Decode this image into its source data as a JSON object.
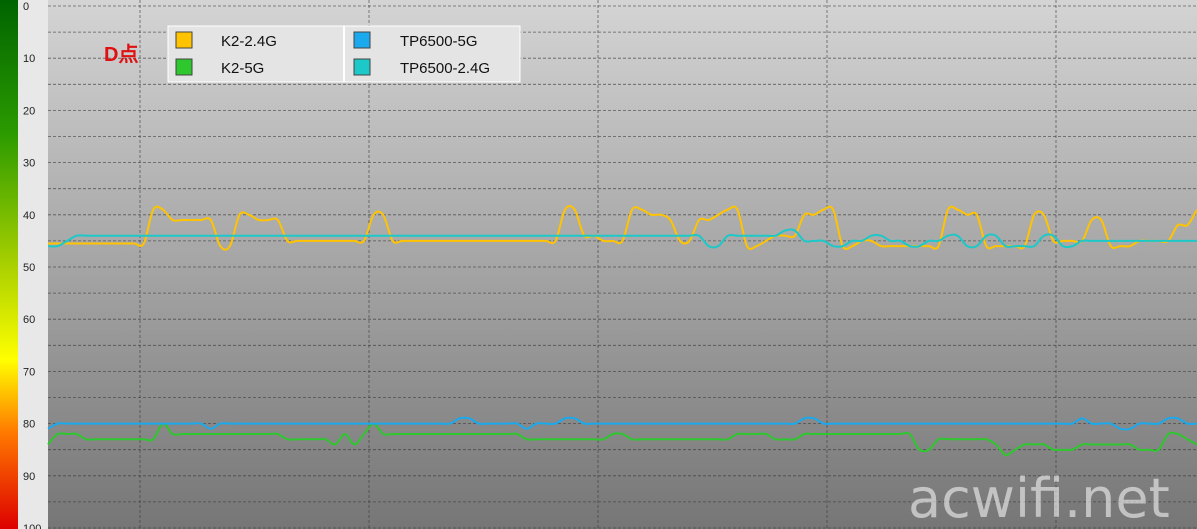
{
  "chart_data": {
    "type": "line",
    "annotation": "D点",
    "watermark": "acwifi.net",
    "ylim": [
      0,
      100
    ],
    "y_inverted": true,
    "yticks": [
      "0",
      "10",
      "20",
      "30",
      "40",
      "50",
      "60",
      "70",
      "80",
      "90",
      "100"
    ],
    "grid": true,
    "legend_position": "top-left",
    "x": [
      0,
      1,
      2,
      3,
      4,
      5,
      6,
      7,
      8,
      9,
      10,
      11,
      12,
      13,
      14,
      15,
      16,
      17,
      18,
      19,
      20,
      21,
      22,
      23,
      24,
      25,
      26,
      27,
      28,
      29,
      30,
      31,
      32,
      33,
      34,
      35,
      36,
      37,
      38,
      39,
      40,
      41,
      42,
      43,
      44,
      45,
      46,
      47,
      48,
      49,
      50,
      51,
      52,
      53,
      54,
      55,
      56,
      57,
      58,
      59,
      60,
      61,
      62,
      63,
      64,
      65,
      66,
      67,
      68,
      69,
      70,
      71,
      72,
      73,
      74,
      75,
      76,
      77,
      78,
      79,
      80,
      81,
      82,
      83,
      84,
      85,
      86,
      87,
      88,
      89,
      90,
      91,
      92,
      93,
      94,
      95,
      96,
      97,
      98,
      99,
      100,
      101,
      102,
      103,
      104,
      105,
      106,
      107,
      108,
      109,
      110,
      111,
      112,
      113,
      114,
      115,
      116,
      117,
      118,
      119,
      120
    ],
    "series": [
      {
        "name": "K2-2.4G",
        "color": "#ffc300",
        "values": [
          45.5,
          45.5,
          45.5,
          45.5,
          45.5,
          45.5,
          45.5,
          45.5,
          45.5,
          45.5,
          45.5,
          39,
          39,
          41,
          41,
          41,
          41,
          41,
          46,
          46,
          40,
          40,
          41,
          41,
          41,
          45,
          45,
          45,
          45,
          45,
          45,
          45,
          45,
          45,
          40,
          40,
          45,
          45,
          45,
          45,
          45,
          45,
          45,
          45,
          45,
          45,
          45,
          45,
          45,
          45,
          45,
          45,
          45,
          45,
          39,
          39,
          44,
          44,
          45,
          45,
          45,
          39,
          39,
          40,
          40,
          41,
          45,
          45,
          41,
          41,
          40,
          39,
          39,
          46,
          46,
          45,
          44,
          44,
          44,
          40,
          40,
          39,
          39,
          46,
          46,
          45,
          45,
          46,
          46,
          46,
          46,
          46,
          46,
          46,
          39,
          39,
          40,
          40,
          46,
          46,
          46,
          46,
          46,
          40,
          40,
          45,
          45,
          45,
          45,
          41,
          41,
          46,
          46,
          46,
          45,
          45,
          45,
          45,
          42,
          42,
          39
        ]
      },
      {
        "name": "K2-5G",
        "color": "#2ec72e",
        "values": [
          84,
          82,
          82,
          82,
          83,
          83,
          83,
          83,
          83,
          83,
          83,
          83,
          80,
          82,
          82,
          82,
          82,
          82,
          82,
          82,
          82,
          82,
          82,
          82,
          82,
          83,
          83,
          83,
          83,
          83,
          84,
          82,
          84,
          82,
          80,
          82,
          82,
          82,
          82,
          82,
          82,
          82,
          82,
          82,
          82,
          82,
          82,
          82,
          82,
          82,
          83,
          83,
          83,
          83,
          83,
          83,
          83,
          83,
          83,
          82,
          82,
          83,
          83,
          83,
          83,
          83,
          83,
          83,
          83,
          83,
          83,
          83,
          82,
          82,
          82,
          82,
          83,
          83,
          83,
          82,
          82,
          82,
          82,
          82,
          82,
          82,
          82,
          82,
          82,
          82,
          82,
          85,
          85,
          83,
          83,
          83,
          83,
          83,
          83,
          84,
          86,
          85,
          84,
          84,
          84,
          85,
          85,
          85,
          84,
          84,
          84,
          84,
          84,
          84,
          85,
          85,
          85,
          82,
          82,
          83,
          84
        ]
      },
      {
        "name": "TP6500-5G",
        "color": "#1aa9ec",
        "values": [
          81,
          80,
          80,
          80,
          80,
          80,
          80,
          80,
          80,
          80,
          80,
          80,
          80,
          80,
          80,
          80,
          80,
          81,
          80,
          80,
          80,
          80,
          80,
          80,
          80,
          80,
          80,
          80,
          80,
          80,
          80,
          80,
          80,
          80,
          80,
          80,
          80,
          80,
          80,
          80,
          80,
          80,
          80,
          79,
          79,
          80,
          80,
          80,
          80,
          80,
          81,
          80,
          80,
          80,
          79,
          79,
          80,
          80,
          80,
          80,
          80,
          80,
          80,
          80,
          80,
          80,
          80,
          80,
          80,
          80,
          80,
          80,
          80,
          80,
          80,
          80,
          80,
          80,
          80,
          79,
          79,
          80,
          80,
          80,
          80,
          80,
          80,
          80,
          80,
          80,
          80,
          80,
          80,
          80,
          80,
          80,
          80,
          80,
          80,
          80,
          80,
          80,
          80,
          80,
          80,
          80,
          80,
          80,
          79,
          80,
          80,
          80,
          81,
          81,
          80,
          80,
          80,
          79,
          79,
          80,
          80
        ]
      },
      {
        "name": "TP6500-2.4G",
        "color": "#1cc8c8",
        "values": [
          46,
          46,
          45,
          44,
          44,
          44,
          44,
          44,
          44,
          44,
          44,
          44,
          44,
          44,
          44,
          44,
          44,
          44,
          44,
          44,
          44,
          44,
          44,
          44,
          44,
          44,
          44,
          44,
          44,
          44,
          44,
          44,
          44,
          44,
          44,
          44,
          44,
          44,
          44,
          44,
          44,
          44,
          44,
          44,
          44,
          44,
          44,
          44,
          44,
          44,
          44,
          44,
          44,
          44,
          44,
          44,
          44,
          44,
          44,
          44,
          44,
          44,
          44,
          44,
          44,
          44,
          44,
          44,
          44,
          46,
          46,
          44,
          44,
          44,
          44,
          44,
          44,
          43,
          43,
          45,
          45,
          45,
          46,
          46,
          45,
          45,
          44,
          44,
          45,
          45,
          46,
          46,
          45,
          45,
          44,
          44,
          46,
          46,
          44,
          44,
          46,
          46,
          46,
          46,
          44,
          44,
          46,
          46,
          45,
          45,
          45,
          45,
          45,
          45,
          45,
          45,
          45,
          45,
          45,
          45,
          45
        ]
      }
    ]
  }
}
